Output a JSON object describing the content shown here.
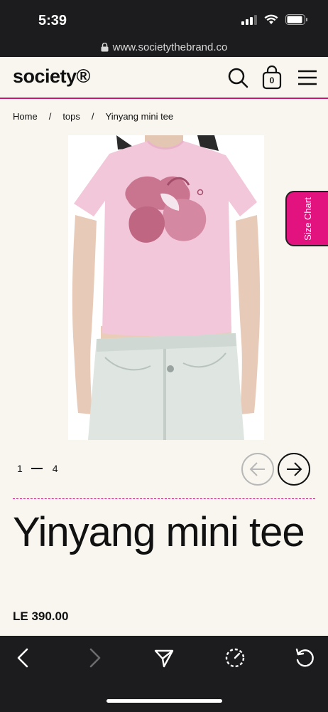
{
  "status_bar": {
    "time": "5:39"
  },
  "browser": {
    "url": "www.societythebrand.co"
  },
  "header": {
    "logo": "society®",
    "cart_count": "0"
  },
  "breadcrumb": {
    "home": "Home",
    "category": "tops",
    "current": "Yinyang mini tee",
    "separator": "/"
  },
  "size_chart": {
    "label": "Size Chart"
  },
  "gallery": {
    "current": "1",
    "total": "4"
  },
  "product": {
    "title": "Yinyang mini tee",
    "price": "LE 390.00"
  },
  "colors": {
    "accent": "#e2127e",
    "divider": "#c2187a",
    "background": "#f8f6ef",
    "shirt": "#f3c7da"
  }
}
